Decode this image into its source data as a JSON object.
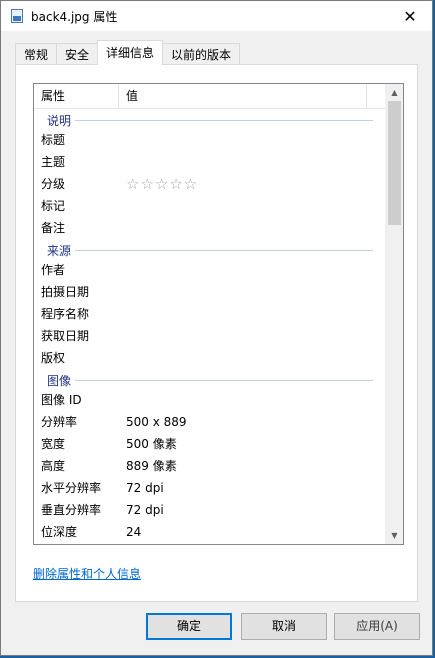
{
  "window": {
    "title": "back4.jpg 属性",
    "close_glyph": "✕"
  },
  "tabs": [
    {
      "label": "常规",
      "active": false
    },
    {
      "label": "安全",
      "active": false
    },
    {
      "label": "详细信息",
      "active": true
    },
    {
      "label": "以前的版本",
      "active": false
    }
  ],
  "columns": {
    "name": "属性",
    "value": "值"
  },
  "groups": {
    "description": {
      "label": "说明",
      "rows": [
        {
          "name": "标题",
          "value": ""
        },
        {
          "name": "主题",
          "value": ""
        },
        {
          "name": "分级",
          "value": "☆☆☆☆☆",
          "rating": 0
        },
        {
          "name": "标记",
          "value": ""
        },
        {
          "name": "备注",
          "value": ""
        }
      ]
    },
    "origin": {
      "label": "来源",
      "rows": [
        {
          "name": "作者",
          "value": ""
        },
        {
          "name": "拍摄日期",
          "value": ""
        },
        {
          "name": "程序名称",
          "value": ""
        },
        {
          "name": "获取日期",
          "value": ""
        },
        {
          "name": "版权",
          "value": ""
        }
      ]
    },
    "image": {
      "label": "图像",
      "rows": [
        {
          "name": "图像 ID",
          "value": ""
        },
        {
          "name": "分辨率",
          "value": "500 x 889"
        },
        {
          "name": "宽度",
          "value": "500 像素"
        },
        {
          "name": "高度",
          "value": "889 像素"
        },
        {
          "name": "水平分辨率",
          "value": "72 dpi"
        },
        {
          "name": "垂直分辨率",
          "value": "72 dpi"
        },
        {
          "name": "位深度",
          "value": "24"
        }
      ]
    }
  },
  "remove_link": "删除属性和个人信息",
  "buttons": {
    "ok": "确定",
    "cancel": "取消",
    "apply": "应用(A)"
  }
}
